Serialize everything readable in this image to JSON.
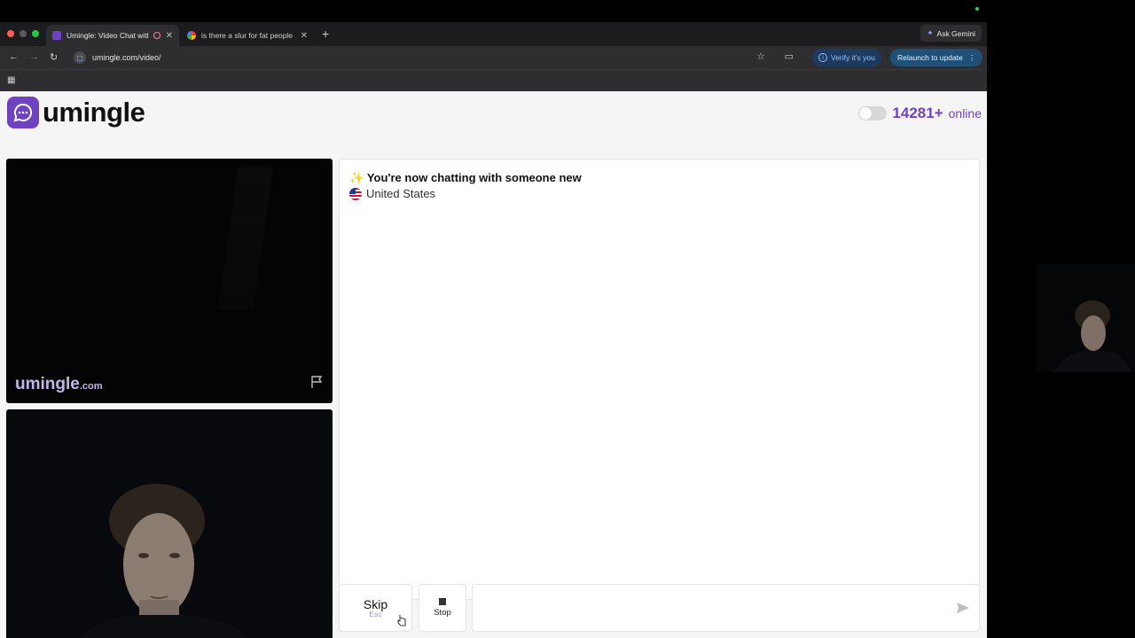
{
  "browser": {
    "tabs": [
      {
        "title": "Umingle: Video Chat with",
        "active": true
      },
      {
        "title": "is there a slur for fat people -",
        "active": false
      }
    ],
    "url": "umingle.com/video/",
    "gemini_label": "Ask Gemini",
    "verify_label": "Verify it's you",
    "relaunch_label": "Relaunch to update"
  },
  "site": {
    "logo_text": "umingle",
    "online_count": "14281+",
    "online_label": "online",
    "watermark_main": "umingle",
    "watermark_suffix": ".com"
  },
  "chat": {
    "sparkle": "✨",
    "message": "You're now chatting with someone new",
    "location": "United States"
  },
  "controls": {
    "skip_label": "Skip",
    "skip_key": "Esc",
    "stop_label": "Stop"
  },
  "colors": {
    "brand": "#6f42c1",
    "watermark": "#c4b5e6",
    "verify_text": "#8ec5ff"
  }
}
